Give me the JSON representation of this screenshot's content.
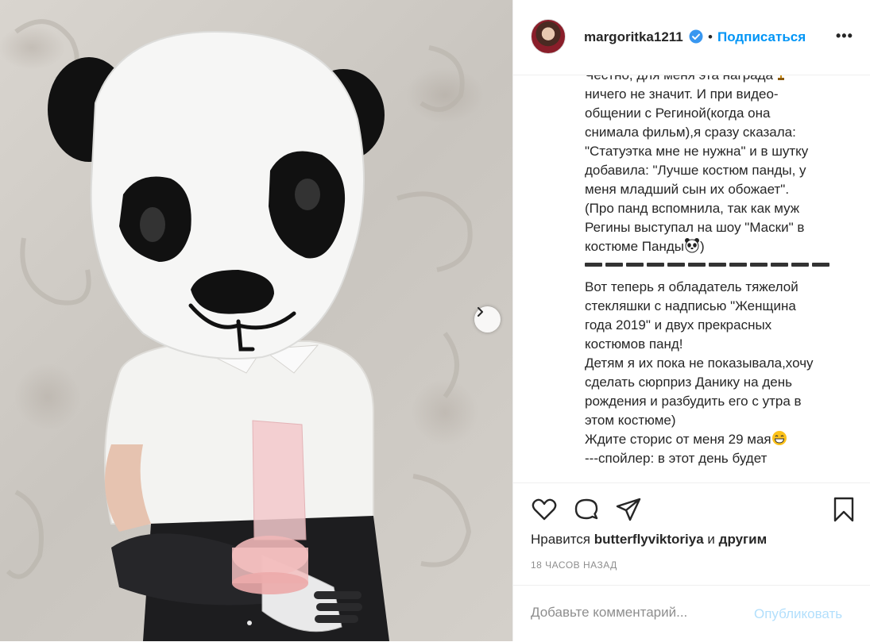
{
  "post": {
    "username": "margoritka1211",
    "verified_icon": "verified-badge-icon",
    "separator": "•",
    "follow_label": "Подписаться",
    "more_label": "•••",
    "caption_lines": [
      "",
      "Честно, для меня эта награда",
      "ничего не значит. И при видео-",
      "общении с Региной(когда она",
      "снимала фильм),я сразу сказала:",
      "\"Статуэтка мне не нужна\" и в шутку",
      "добавила: \"Лучше костюм панды, у",
      "меня младший сын их обожает\".",
      "(Про панд вспомнила, так как муж",
      "Регины выступал на шоу \"Маски\" в",
      "костюме Панды",
      "",
      "Вот теперь я обладатель тяжелой",
      "стекляшки с надписью \"Женщина",
      "года 2019\" и двух прекрасных",
      "костюмов панд!",
      "Детям я их пока не показывала,хочу",
      "сделать сюрприз Данику на день",
      "рождения и разбудить его с утра в",
      "этом костюме)",
      "Ждите сторис от меня 29 мая",
      "---спойлер: в этот день будет"
    ],
    "panda_suffix": ")",
    "likes_prefix": "Нравится",
    "likes_user": "butterflyviktoriya",
    "likes_and": "и",
    "likes_others": "другим",
    "timestamp": "18 ЧАСОВ НАЗАД",
    "comment_placeholder": "Добавьте комментарий...",
    "publish_label": "Опубликовать",
    "colors": {
      "link": "#0095f6",
      "text": "#262626",
      "muted": "#8e8e8e",
      "publish_disabled": "#b2dffc"
    }
  },
  "photo": {
    "next_icon": "chevron-right-icon",
    "carousel_dots": 1
  }
}
